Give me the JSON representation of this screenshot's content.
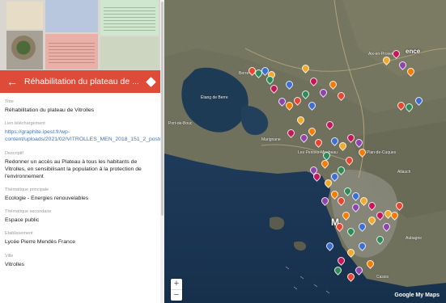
{
  "titlebar": {
    "title": "Réhabilitation du plateau de ..."
  },
  "fields": [
    {
      "label": "Titre",
      "value": "Réhabilitation du plateau de Vitrolles",
      "link": false
    },
    {
      "label": "Lien téléchargement",
      "value": "https://graphite.ipest.fr/wp-content/uploads/2021/02/VITROLLES_MEN_2018_151_2_poster_A2.pdf",
      "link": true
    },
    {
      "label": "Descriptif",
      "value": "Redonner un accès au Plateau à tous les habitants de Vitrolles, en sensibilisant la population à la protection de l'environnement",
      "link": false
    },
    {
      "label": "Thématique principale",
      "value": "Ecologie - Energies renouvelables",
      "link": false
    },
    {
      "label": "Thématique secondaire",
      "value": "Espace public",
      "link": false
    },
    {
      "label": "Etablissement",
      "value": "Lycée Pierre Mendès France",
      "link": false
    },
    {
      "label": "Ville",
      "value": "Vitrolles",
      "link": false
    }
  ],
  "map": {
    "place_labels": [
      "Aix-en-Provence",
      "Étang de Berre",
      "Berre-l'Étang",
      "Marignane",
      "Les Pennes-Mirabeau",
      "Plan-de-Cuques",
      "Allauch",
      "Aubagne",
      "Cassis",
      "Port-de-Bouc"
    ],
    "city_label": "M",
    "city_label_2": "ence",
    "zoom_in": "+",
    "zoom_out": "−",
    "brand": "Google My Maps"
  },
  "marker_colors": [
    "#e6462f",
    "#2e8b57",
    "#3d6fd1",
    "#f0a92a",
    "#c2185b",
    "#8e44ad",
    "#f57c00"
  ]
}
